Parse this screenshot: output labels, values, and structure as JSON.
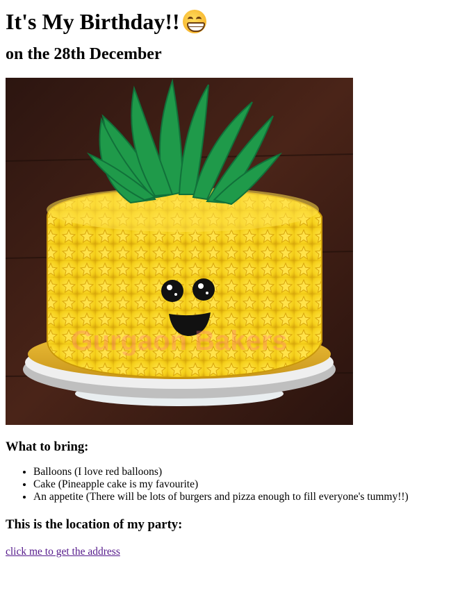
{
  "title": "It's My Birthday!!",
  "title_emoji": "grinning-face-emoji",
  "subtitle": "on the 28th December",
  "cake_image": {
    "name": "pineapple-cake-image",
    "watermark": "Gurgaon Bakers"
  },
  "bring": {
    "heading": "What to bring:",
    "items": [
      "Balloons (I love red balloons)",
      "Cake (Pineapple cake is my favourite)",
      "An appetite (There will be lots of burgers and pizza enough to fill everyone's tummy!!)"
    ]
  },
  "location": {
    "heading": "This is the location of my party:",
    "link_text": "click me to get the address"
  },
  "colors": {
    "link_visited": "#551a8b",
    "cake_yellow": "#f5d21c",
    "leaf_green": "#1f9a4a",
    "background_wood": "#3a1f14"
  }
}
